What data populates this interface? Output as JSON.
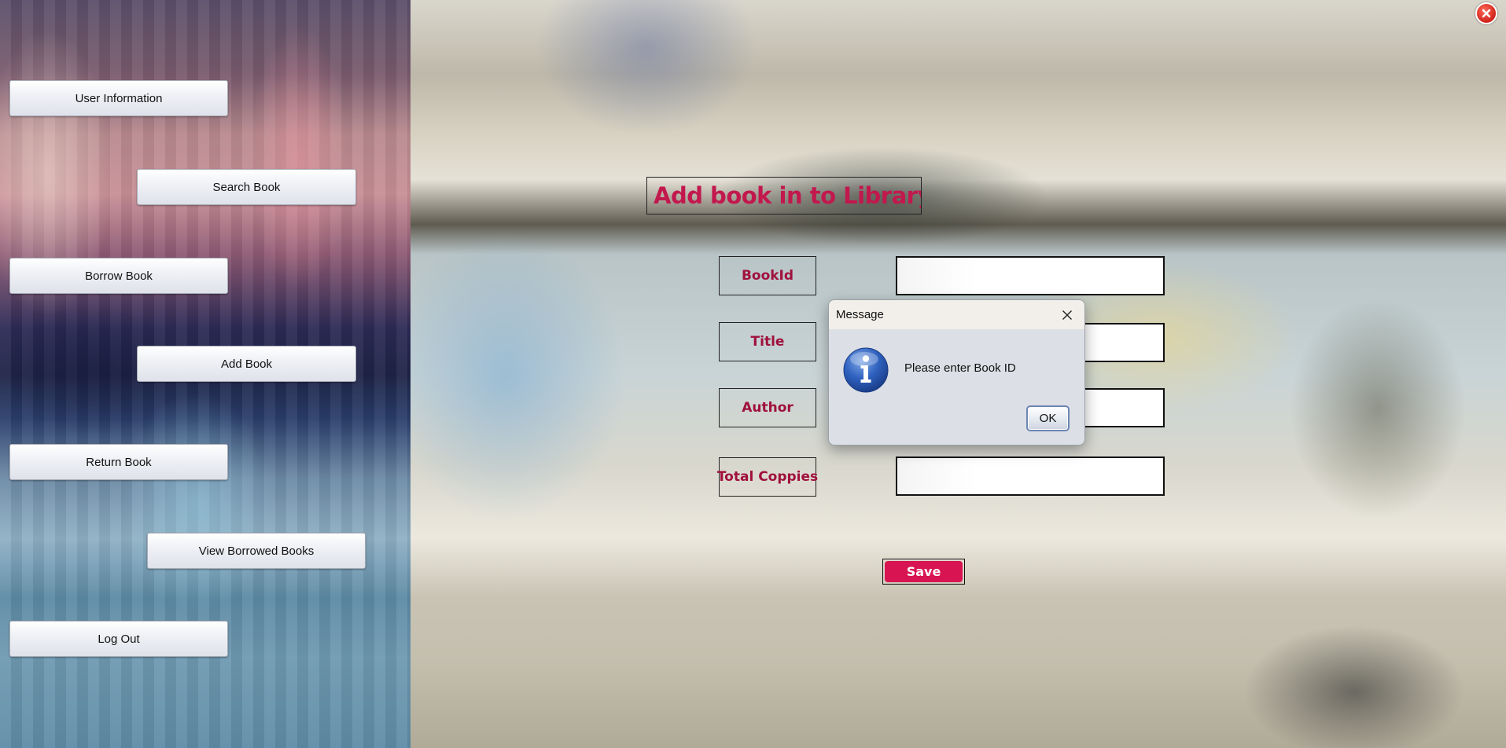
{
  "window": {
    "close_icon": "close-icon"
  },
  "sidebar": {
    "buttons": [
      {
        "label": "User Information"
      },
      {
        "label": "Search Book"
      },
      {
        "label": "Borrow Book"
      },
      {
        "label": "Add Book"
      },
      {
        "label": "Return Book"
      },
      {
        "label": "View Borrowed Books"
      },
      {
        "label": "Log Out"
      }
    ]
  },
  "form": {
    "title": "Add book in to Library..",
    "fields": [
      {
        "label": "BookId",
        "value": ""
      },
      {
        "label": "Title",
        "value": ""
      },
      {
        "label": "Author",
        "value": ""
      },
      {
        "label": "Total Coppies",
        "value": ""
      }
    ],
    "save_label": "Save"
  },
  "dialog": {
    "title": "Message",
    "message": "Please enter Book ID",
    "ok_label": "OK",
    "icon": "info-icon"
  },
  "colors": {
    "title_text": "#c2184e",
    "label_text": "#a0103c",
    "save_button": "#d81452"
  }
}
